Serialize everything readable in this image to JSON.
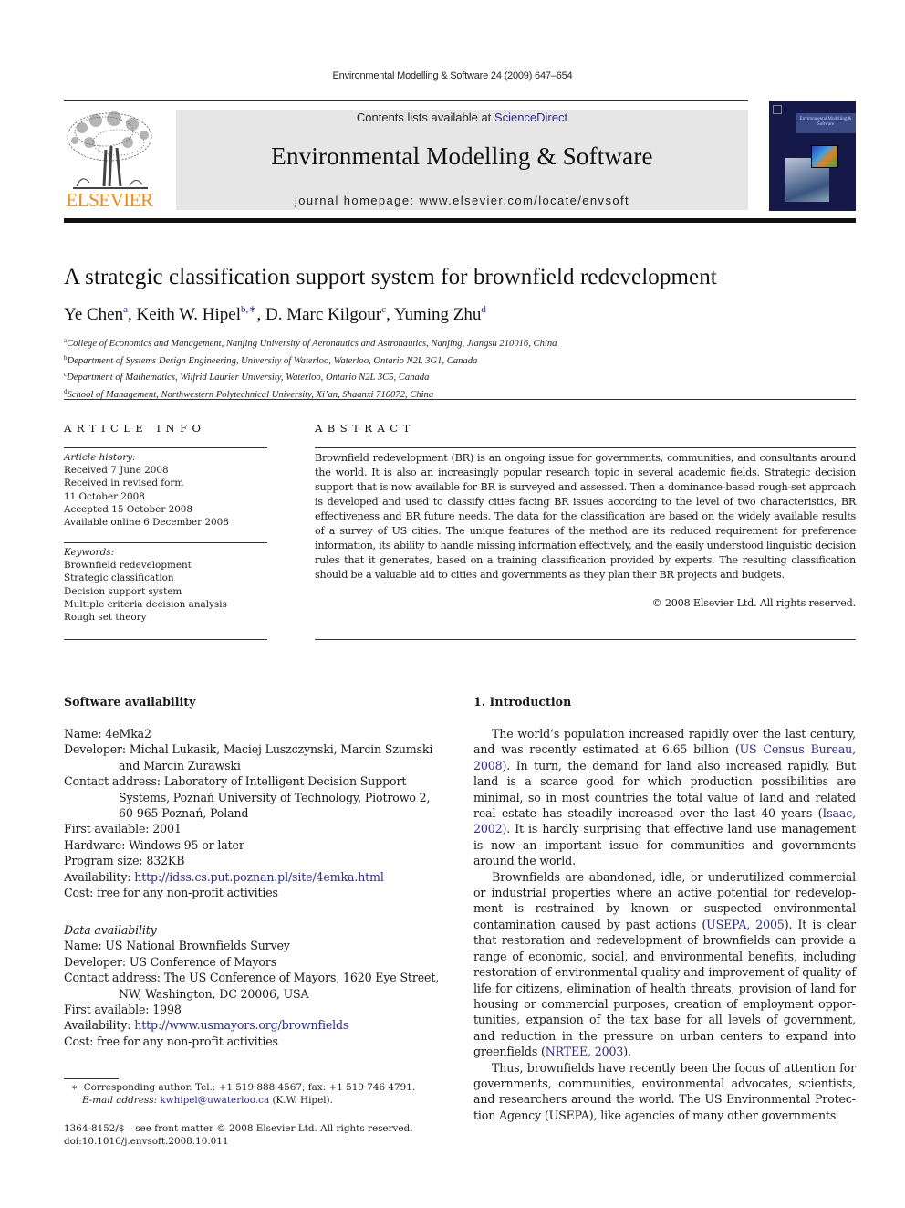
{
  "running_head": "Environmental Modelling & Software 24 (2009) 647–654",
  "header": {
    "publisher_logo": "ELSEVIER",
    "contents_prefix": "Contents lists available at ",
    "contents_link": "ScienceDirect",
    "journal_title": "Environmental Modelling & Software",
    "homepage": "journal homepage: www.elsevier.com/locate/envsoft",
    "cover_title": "Environmental Modelling & Software"
  },
  "article": {
    "title": "A strategic classification support system for brownfield redevelopment",
    "authors": [
      {
        "name": "Ye Chen",
        "sup": "a"
      },
      {
        "name": "Keith W. Hipel",
        "sup": "b,∗"
      },
      {
        "name": "D. Marc Kilgour",
        "sup": "c"
      },
      {
        "name": "Yuming Zhu",
        "sup": "d"
      }
    ],
    "affiliations": [
      {
        "key": "a",
        "text": "College of Economics and Management, Nanjing University of Aeronautics and Astronautics, Nanjing, Jiangsu 210016, China"
      },
      {
        "key": "b",
        "text": "Department of Systems Design Engineering, University of Waterloo, Waterloo, Ontario N2L 3G1, Canada"
      },
      {
        "key": "c",
        "text": "Department of Mathematics, Wilfrid Laurier University, Waterloo, Ontario N2L 3C5, Canada"
      },
      {
        "key": "d",
        "text": "School of Management, Northwestern Polytechnical University, Xi’an, Shaanxi 710072, China"
      }
    ]
  },
  "article_info": {
    "heading": "ARTICLE INFO",
    "history_label": "Article history:",
    "history": [
      "Received 7 June 2008",
      "Received in revised form",
      "11 October 2008",
      "Accepted 15 October 2008",
      "Available online 6 December 2008"
    ],
    "keywords_label": "Keywords:",
    "keywords": [
      "Brownfield redevelopment",
      "Strategic classification",
      "Decision support system",
      "Multiple criteria decision analysis",
      "Rough set theory"
    ]
  },
  "abstract": {
    "heading": "ABSTRACT",
    "text": "Brownfield redevelopment (BR) is an ongoing issue for governments, communities, and consultants around the world. It is also an increasingly popular research topic in several academic fields. Strategic decision support that is now available for BR is surveyed and assessed. Then a dominance-based rough-set approach is developed and used to classify cities facing BR issues according to the level of two characteristics, BR effectiveness and BR future needs. The data for the classification are based on the widely available results of a survey of US cities. The unique features of the method are its reduced requirement for preference information, its ability to handle missing information effectively, and the easily understood linguistic decision rules that it generates, based on a training classification provided by experts. The resulting classification should be a valuable aid to cities and governments as they plan their BR projects and budgets.",
    "copyright": "© 2008 Elsevier Ltd. All rights reserved."
  },
  "software_availability": {
    "heading": "Software availability",
    "entries": [
      {
        "label": "Name: ",
        "value": "4eMka2"
      },
      {
        "label": "Developer: ",
        "value": "Michal Lukasik, Maciej Luszczynski, Marcin Szumski and Marcin Zurawski"
      },
      {
        "label": "Contact address: ",
        "value": "Laboratory of Intelligent Decision Support Systems, Poznań University of Technology, Piotrowo 2, 60-965 Poznań, Poland"
      },
      {
        "label": "First available: ",
        "value": "2001"
      },
      {
        "label": "Hardware: ",
        "value": "Windows 95 or later"
      },
      {
        "label": "Program size: ",
        "value": "832KB"
      },
      {
        "label": "Availability: ",
        "value": "http://idss.cs.put.poznan.pl/site/4emka.html",
        "link": true
      },
      {
        "label": "Cost: ",
        "value": "free for any non-profit activities"
      }
    ]
  },
  "data_availability": {
    "heading": "Data availability",
    "entries": [
      {
        "label": "Name: ",
        "value": "US National Brownfields Survey"
      },
      {
        "label": "Developer: ",
        "value": "US Conference of Mayors"
      },
      {
        "label": "Contact address: ",
        "value": "The US Conference of Mayors, 1620 Eye Street, NW, Washington, DC 20006, USA"
      },
      {
        "label": "First available: ",
        "value": "1998"
      },
      {
        "label": "Availability: ",
        "value": "http://www.usmayors.org/brownfields",
        "link": true
      },
      {
        "label": "Cost: ",
        "value": "free for any non-profit activities"
      }
    ]
  },
  "footnote": {
    "marker": "∗",
    "corresponding": "Corresponding author. Tel.: +1 519 888 4567; fax: +1 519 746 4791.",
    "email_label": "E-mail address: ",
    "email": "kwhipel@uwaterloo.ca",
    "email_suffix": " (K.W. Hipel)."
  },
  "front_matter": {
    "line1": "1364-8152/$ – see front matter © 2008 Elsevier Ltd. All rights reserved.",
    "doi": "doi:10.1016/j.envsoft.2008.10.011"
  },
  "introduction": {
    "heading": "1.  Introduction",
    "paragraphs": [
      [
        {
          "t": "The world’s population increased rapidly over the last century, and was recently estimated at 6.65 billion ("
        },
        {
          "t": "US Census Bureau, 2008",
          "link": true
        },
        {
          "t": "). In turn, the demand for land also increased rapidly. But land is a scarce good for which production possibilities are minimal, so in most countries the total value of land and related real estate has steadily increased over the last 40 years ("
        },
        {
          "t": "Isaac, 2002",
          "link": true
        },
        {
          "t": "). It is hardly surprising that effective land use management is now an important issue for communities and governments around the world."
        }
      ],
      [
        {
          "t": "Brownfields are abandoned, idle, or underutilized commercial or industrial properties where an active potential for redevelop­ment is restrained by known or suspected environmental contamination caused by past actions ("
        },
        {
          "t": "USEPA, 2005",
          "link": true
        },
        {
          "t": "). It is clear that restoration and redevelopment of brownfields can provide a range of economic, social, and environmental benefits, including resto­ration of environmental quality and improvement of quality of life for citizens, elimination of health threats, provision of land for housing or commercial purposes, creation of employment oppor­tunities, expansion of the tax base for all levels of government, and reduction in the pressure on urban centers to expand into green­fields ("
        },
        {
          "t": "NRTEE, 2003",
          "link": true
        },
        {
          "t": ")."
        }
      ],
      [
        {
          "t": "Thus, brownfields have recently been the focus of attention for governments, communities, environmental advocates, scientists, and researchers around the world. The US Environmental Protec­tion Agency (USEPA), like agencies of many other governments"
        }
      ]
    ]
  },
  "colors": {
    "link": "#2b2b8c",
    "elsevier_orange": "#f08a1c",
    "banner_gray": "#e6e6e6",
    "cover_navy": "#14194a"
  }
}
